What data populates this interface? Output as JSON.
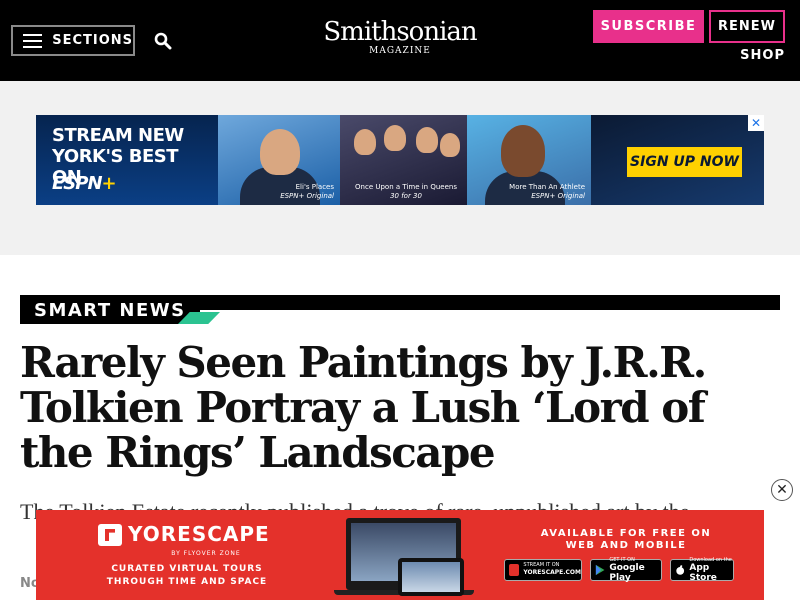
{
  "header": {
    "sections_label": "SECTIONS",
    "logo_main": "Smithsonian",
    "logo_sub": "MAGAZINE",
    "subscribe_label": "SUBSCRIBE",
    "renew_label": "RENEW",
    "shop_label": "SHOP",
    "accent_color": "#e8308b"
  },
  "top_ad": {
    "headline": "STREAM NEW YORK'S BEST ON",
    "brand": "ESPN",
    "brand_plus": "+",
    "panels": [
      {
        "title": "Eli's Places",
        "subtitle": "ESPN+ Original"
      },
      {
        "title": "Once Upon a Time in Queens",
        "subtitle": "30 for 30"
      },
      {
        "title": "More Than An Athlete",
        "subtitle": "ESPN+ Original"
      }
    ],
    "cta": "SIGN UP NOW",
    "close_glyph": "✕"
  },
  "article": {
    "section_label": "SMART NEWS",
    "section_accent_color": "#2bc391",
    "headline": "Rarely Seen Paintings by J.R.R. Tolkien Portray a Lush ‘Lord of the Rings’ Landscape",
    "dek": "The Tolkien Estate recently published a trove of rare, unpublished art by the",
    "byline": "No"
  },
  "bottom_ad": {
    "brand": "YORESCAPE",
    "by_line": "BY FLYOVER ZONE",
    "tagline_1": "CURATED VIRTUAL TOURS",
    "tagline_2": "THROUGH TIME AND SPACE",
    "availability_1": "AVAILABLE FOR FREE ON",
    "availability_2": "WEB AND MOBILE",
    "badges": [
      {
        "small": "STREAM IT ON",
        "big": "YORESCAPE.COM"
      },
      {
        "small": "GET IT ON",
        "big": "Google Play"
      },
      {
        "small": "Download on the",
        "big": "App Store"
      }
    ],
    "close_glyph": "✕",
    "background_color": "#e4312b"
  }
}
